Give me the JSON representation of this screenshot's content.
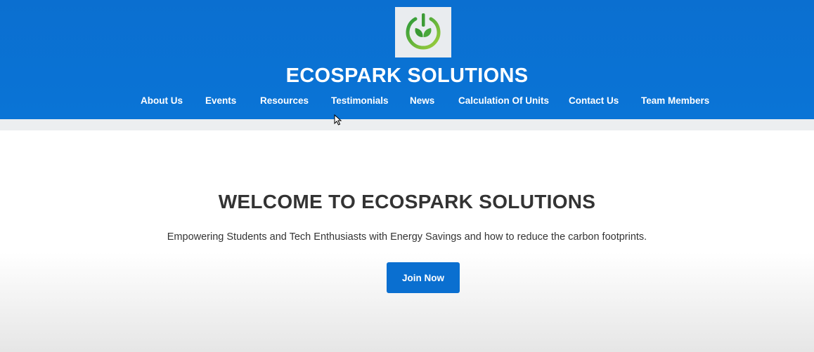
{
  "header": {
    "logo_icon": "power-leaf-logo-icon",
    "title": "ECOSPARK SOLUTIONS",
    "nav": [
      {
        "label": "About Us"
      },
      {
        "label": "Events"
      },
      {
        "label": "Resources"
      },
      {
        "label": "Testimonials"
      },
      {
        "label": "News"
      },
      {
        "label": "Calculation Of Units"
      },
      {
        "label": "Contact Us"
      },
      {
        "label": "Team Members"
      }
    ]
  },
  "hero": {
    "title": "WELCOME TO ECOSPARK SOLUTIONS",
    "subtitle": "Empowering Students and Tech Enthusiasts with Energy Savings and how to reduce the carbon footprints.",
    "cta_label": "Join Now"
  },
  "colors": {
    "header_bg": "#0a74d6",
    "button_bg": "#0a6fd0",
    "logo_green": "#3fa535",
    "logo_lime": "#8cc63f",
    "text_dark": "#333333"
  }
}
